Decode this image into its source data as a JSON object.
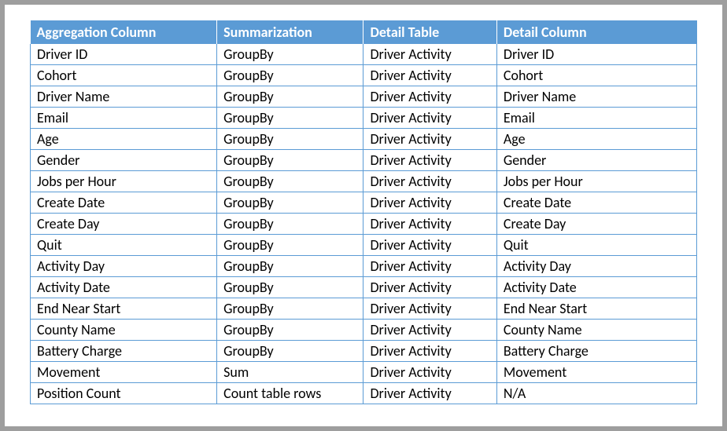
{
  "table": {
    "headers": [
      "Aggregation Column",
      "Summarization",
      "Detail Table",
      "Detail Column"
    ],
    "rows": [
      {
        "aggregation_column": "Driver ID",
        "summarization": "GroupBy",
        "detail_table": "Driver Activity",
        "detail_column": "Driver ID"
      },
      {
        "aggregation_column": "Cohort",
        "summarization": "GroupBy",
        "detail_table": "Driver Activity",
        "detail_column": "Cohort"
      },
      {
        "aggregation_column": "Driver Name",
        "summarization": "GroupBy",
        "detail_table": "Driver Activity",
        "detail_column": "Driver Name"
      },
      {
        "aggregation_column": "Email",
        "summarization": "GroupBy",
        "detail_table": "Driver Activity",
        "detail_column": "Email"
      },
      {
        "aggregation_column": "Age",
        "summarization": "GroupBy",
        "detail_table": "Driver Activity",
        "detail_column": "Age"
      },
      {
        "aggregation_column": "Gender",
        "summarization": "GroupBy",
        "detail_table": "Driver Activity",
        "detail_column": "Gender"
      },
      {
        "aggregation_column": "Jobs per Hour",
        "summarization": "GroupBy",
        "detail_table": "Driver Activity",
        "detail_column": "Jobs per Hour"
      },
      {
        "aggregation_column": "Create Date",
        "summarization": "GroupBy",
        "detail_table": "Driver Activity",
        "detail_column": "Create Date"
      },
      {
        "aggregation_column": "Create Day",
        "summarization": "GroupBy",
        "detail_table": "Driver Activity",
        "detail_column": "Create Day"
      },
      {
        "aggregation_column": "Quit",
        "summarization": "GroupBy",
        "detail_table": "Driver Activity",
        "detail_column": "Quit"
      },
      {
        "aggregation_column": "Activity Day",
        "summarization": "GroupBy",
        "detail_table": "Driver Activity",
        "detail_column": "Activity Day"
      },
      {
        "aggregation_column": "Activity Date",
        "summarization": "GroupBy",
        "detail_table": "Driver Activity",
        "detail_column": "Activity Date"
      },
      {
        "aggregation_column": "End Near Start",
        "summarization": "GroupBy",
        "detail_table": "Driver Activity",
        "detail_column": "End Near Start"
      },
      {
        "aggregation_column": "County Name",
        "summarization": "GroupBy",
        "detail_table": "Driver Activity",
        "detail_column": "County Name"
      },
      {
        "aggregation_column": "Battery Charge",
        "summarization": "GroupBy",
        "detail_table": "Driver Activity",
        "detail_column": "Battery Charge"
      },
      {
        "aggregation_column": "Movement",
        "summarization": "Sum",
        "detail_table": "Driver Activity",
        "detail_column": "Movement"
      },
      {
        "aggregation_column": "Position Count",
        "summarization": "Count table rows",
        "detail_table": "Driver Activity",
        "detail_column": "N/A"
      }
    ]
  }
}
